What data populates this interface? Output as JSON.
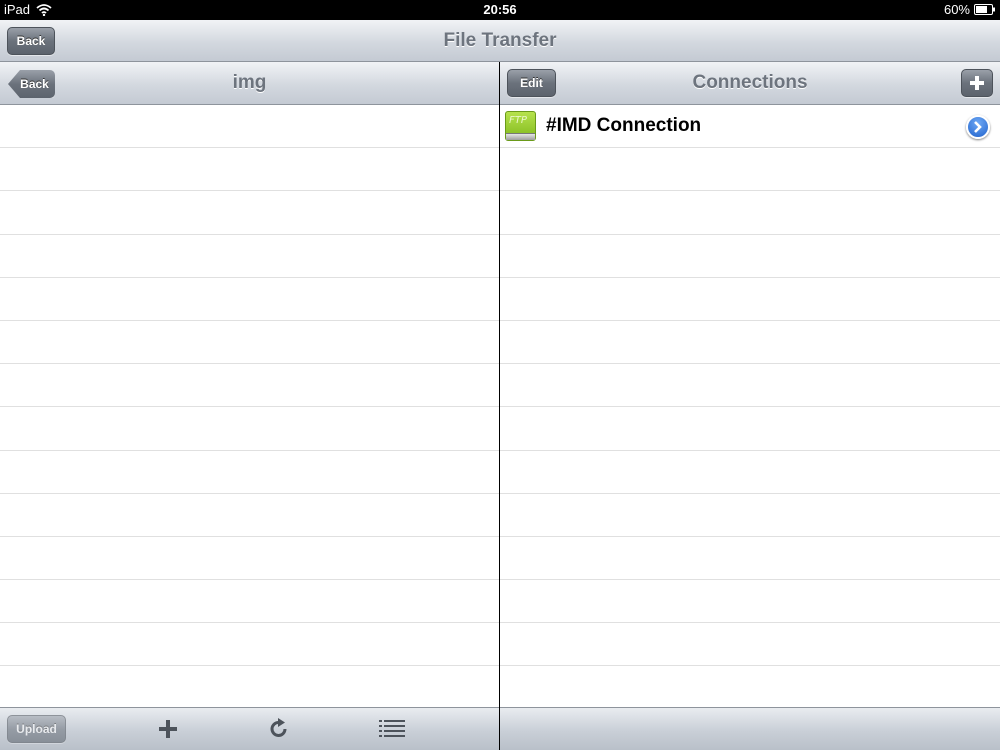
{
  "status_bar": {
    "device": "iPad",
    "time": "20:56",
    "battery": "60%",
    "icons": [
      "wifi-icon",
      "battery-icon"
    ]
  },
  "main_toolbar": {
    "title": "File Transfer",
    "back_label": "Back"
  },
  "left_panel": {
    "title": "img",
    "back_label": "Back",
    "rows": 14,
    "bottom_toolbar": {
      "upload_label": "Upload",
      "icons": [
        "add-icon",
        "refresh-icon",
        "list-icon"
      ]
    }
  },
  "right_panel": {
    "title": "Connections",
    "edit_label": "Edit",
    "add_icon": "plus-icon",
    "connections": [
      {
        "label": "#IMD Connection",
        "icon": "ftp-icon",
        "icon_text": "FTP"
      }
    ]
  },
  "colors": {
    "toolbar_title": "#6d747e",
    "button": "#6b727c",
    "disclosure": "#2163cc",
    "ftp_icon": "#9bd033"
  }
}
